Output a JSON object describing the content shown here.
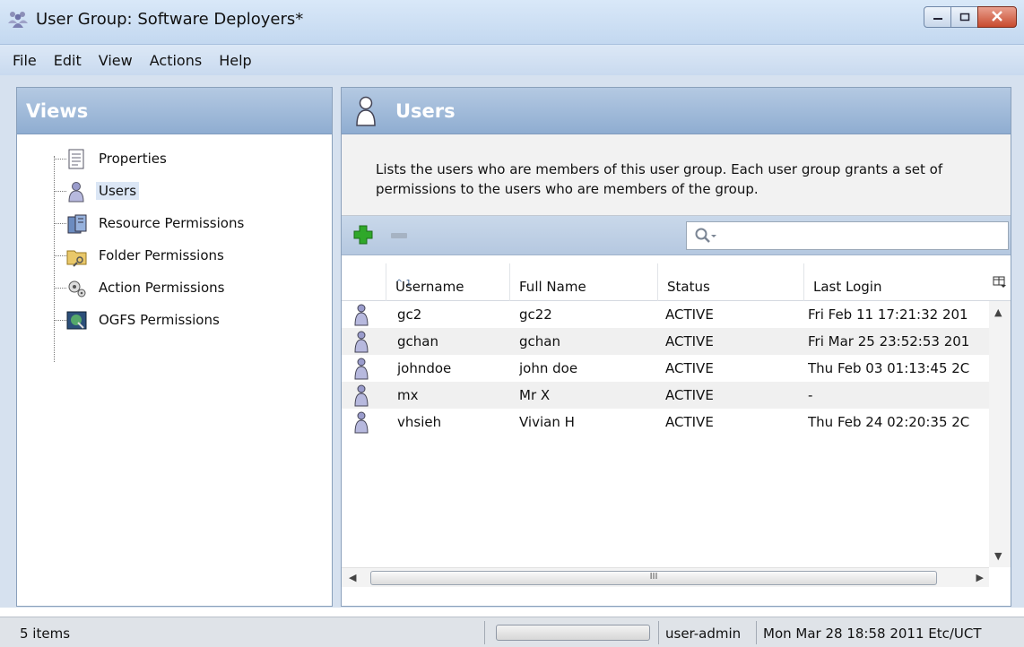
{
  "window": {
    "title": "User Group: Software Deployers*"
  },
  "menu": {
    "items": [
      "File",
      "Edit",
      "View",
      "Actions",
      "Help"
    ]
  },
  "views_panel": {
    "title": "Views",
    "items": [
      {
        "label": "Properties",
        "icon": "properties-icon"
      },
      {
        "label": "Users",
        "icon": "user-icon",
        "selected": true
      },
      {
        "label": "Resource Permissions",
        "icon": "server-icon"
      },
      {
        "label": "Folder Permissions",
        "icon": "folder-icon"
      },
      {
        "label": "Action Permissions",
        "icon": "gears-icon"
      },
      {
        "label": "OGFS Permissions",
        "icon": "ogfs-icon"
      }
    ]
  },
  "users_panel": {
    "title": "Users",
    "description": "Lists the users who are members of this user group. Each user group grants a set of permissions to the users who are members of the group.",
    "columns": [
      "Username",
      "Full Name",
      "Status",
      "Last Login"
    ],
    "sort_indicator": "^ 1",
    "rows": [
      {
        "username": "gc2",
        "full_name": "gc22",
        "status": "ACTIVE",
        "last_login": "Fri Feb 11 17:21:32 201"
      },
      {
        "username": "gchan",
        "full_name": "gchan",
        "status": "ACTIVE",
        "last_login": "Fri Mar 25 23:52:53 201"
      },
      {
        "username": "johndoe",
        "full_name": "john doe",
        "status": "ACTIVE",
        "last_login": "Thu Feb 03 01:13:45 2C"
      },
      {
        "username": "mx",
        "full_name": "Mr X",
        "status": "ACTIVE",
        "last_login": "-"
      },
      {
        "username": "vhsieh",
        "full_name": "Vivian H",
        "status": "ACTIVE",
        "last_login": "Thu Feb 24 02:20:35 2C"
      }
    ],
    "hscroll_grip": "III"
  },
  "statusbar": {
    "count": "5 items",
    "user": "user-admin",
    "time": "Mon Mar 28 18:58 2011 Etc/UCT"
  },
  "colors": {
    "header_blue": "#8fadd1",
    "add_green": "#2fa82a"
  }
}
